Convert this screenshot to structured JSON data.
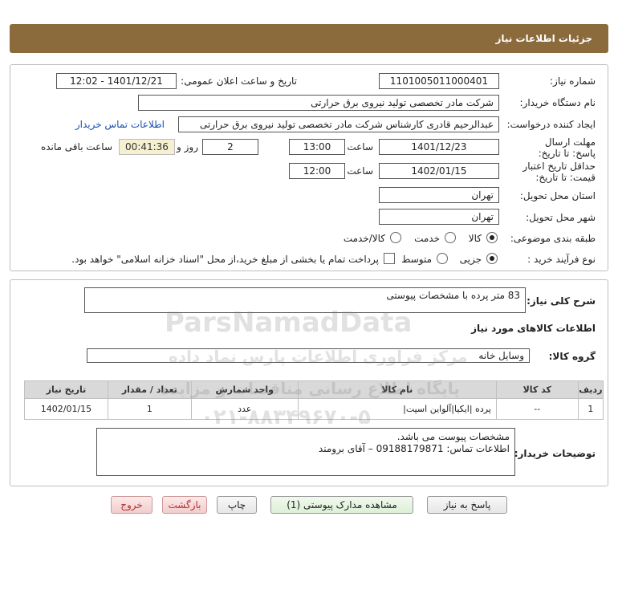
{
  "header": {
    "title": "جزئیات اطلاعات نیاز"
  },
  "form": {
    "need_number_label": "شماره نیاز:",
    "need_number": "1101005011000401",
    "announce_label": "تاریخ و ساعت اعلان عمومی:",
    "announce_value": "1401/12/21 - 12:02",
    "buyer_org_label": "نام دستگاه خریدار:",
    "buyer_org": "شرکت مادر تخصصی تولید نیروی برق حرارتی",
    "requester_label": "ایجاد کننده درخواست:",
    "requester": "عبدالرحیم قادری کارشناس شرکت مادر تخصصی تولید نیروی برق حرارتی",
    "contact_link": "اطلاعات تماس خریدار",
    "reply_deadline_label": "مهلت ارسال پاسخ: تا تاریخ:",
    "reply_date": "1401/12/23",
    "time_label": "ساعت",
    "reply_time": "13:00",
    "days_value": "2",
    "days_label": "روز و",
    "remaining_time": "00:41:36",
    "remaining_label": "ساعت باقی مانده",
    "validity_label": "حداقل تاریخ اعتبار قیمت: تا تاریخ:",
    "validity_date": "1402/01/15",
    "validity_time_label": "ساعت",
    "validity_time": "12:00",
    "province_label": "استان محل تحویل:",
    "province": "تهران",
    "city_label": "شهر محل تحویل:",
    "city": "تهران",
    "category_label": "طبقه بندی موضوعی:",
    "category_options": [
      "کالا",
      "خدمت",
      "کالا/خدمت"
    ],
    "category_selected": "کالا",
    "process_label": "نوع فرآیند خرید :",
    "process_options": [
      "جزیی",
      "متوسط"
    ],
    "process_selected": "جزیی",
    "treasury_note": "پرداخت تمام یا بخشی از مبلغ خرید،از محل \"اسناد خزانه اسلامی\" خواهد بود."
  },
  "details": {
    "summary_label": "شرح کلی نیاز:",
    "summary": "83 متر پرده با مشخصات پیوستی",
    "goods_info_title": "اطلاعات کالاهای مورد نیاز",
    "goods_group_label": "گروه کالا:",
    "goods_group": "وسایل خانه",
    "table": {
      "headers": [
        "ردیف",
        "کد کالا",
        "نام کالا",
        "واحد شمارش",
        "تعداد / مقدار",
        "تاریخ نیاز"
      ],
      "rows": [
        [
          "1",
          "--",
          "پرده |ایکیا|آلواین اسپت|",
          "عدد",
          "1",
          "1402/01/15"
        ]
      ]
    },
    "buyer_notes_label": "توضیحات خریدار:",
    "buyer_notes_line1": "مشخصات پیوست می باشد.",
    "buyer_notes_line2": "اطلاعات تماس: 09188179871 – آقای برومند"
  },
  "buttons": {
    "reply": "پاسخ به نیاز",
    "view_docs": "مشاهده مدارک پیوستی (1)",
    "print": "چاپ",
    "back": "بازگشت",
    "exit": "خروج"
  },
  "watermark": {
    "brand": "ParsNamadData",
    "line1": "مرکز فراوری اطلاعات پارس نماد داده",
    "line2": "پایگاه اطلاع رسانی مناقصات و مزایده",
    "phone": "۰۲۱-۸۸۳۴۹۶۷۰-۵"
  },
  "colors": {
    "header_bg": "#8b6a3c",
    "link": "#1a4fb0",
    "remaining_bg": "#f5f0d0"
  }
}
